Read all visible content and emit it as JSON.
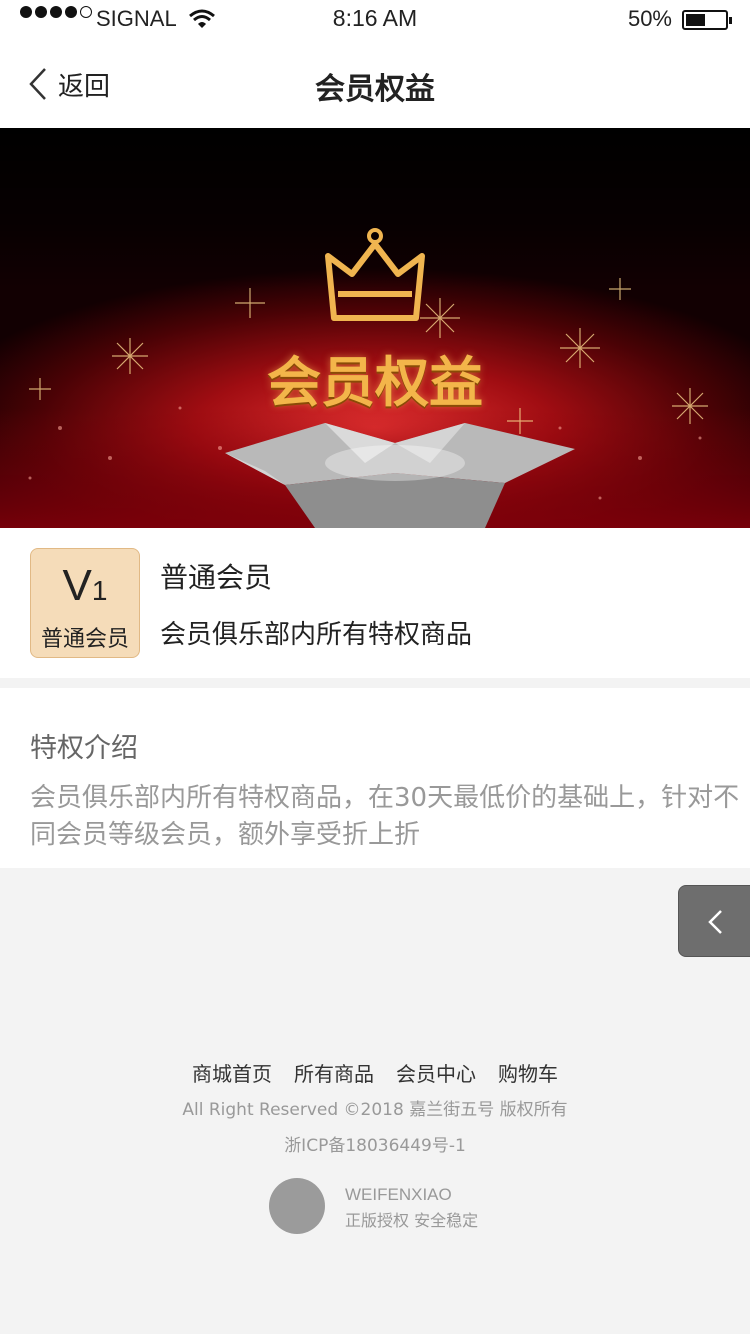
{
  "status_bar": {
    "carrier": "SIGNAL",
    "time": "8:16 AM",
    "battery_percent": "50%",
    "battery_level": 0.5
  },
  "nav": {
    "back_label": "返回",
    "title": "会员权益"
  },
  "banner": {
    "title": "会员权益"
  },
  "member": {
    "level_letter": "V",
    "level_number": "1",
    "level_name": "普通会员",
    "name": "普通会员",
    "description": "会员俱乐部内所有特权商品"
  },
  "intro": {
    "title": "特权介绍",
    "body": "会员俱乐部内所有特权商品，在30天最低价的基础上，针对不同会员等级会员，额外享受折上折"
  },
  "footer": {
    "links": [
      "商城首页",
      "所有商品",
      "会员中心",
      "购物车"
    ],
    "copyright": "All Right Reserved ©2018 嘉兰街五号 版权所有",
    "icp": "浙ICP备18036449号-1",
    "brand_name": "WEIFENXIAO",
    "brand_slogan": "正版授权  安全稳定"
  },
  "colors": {
    "accent_gold": "#f3b54a",
    "badge_bg": "#f5dcb9",
    "banner_red": "#a00d12"
  },
  "icons": [
    "back-chevron-icon",
    "wifi-icon",
    "battery-icon",
    "crown-icon",
    "gift-box-icon",
    "float-back-chevron-icon"
  ]
}
